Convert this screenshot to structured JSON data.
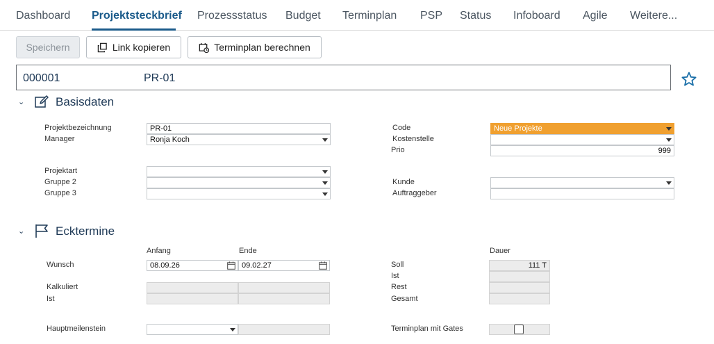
{
  "tabs": [
    "Dashboard",
    "Projektsteckbrief",
    "Prozessstatus",
    "Budget",
    "Terminplan",
    "PSP",
    "Status",
    "Infoboard",
    "Agile",
    "Weitere..."
  ],
  "toolbar": {
    "save": "Speichern",
    "copy_link": "Link kopieren",
    "calc_schedule": "Terminplan berechnen"
  },
  "header": {
    "number": "000001",
    "name": "PR-01"
  },
  "basisdaten": {
    "title": "Basisdaten",
    "projektbezeichnung_label": "Projektbezeichnung",
    "projektbezeichnung": "PR-01",
    "manager_label": "Manager",
    "manager": "Ronja Koch",
    "code_label": "Code",
    "code": "Neue Projekte",
    "kostenstelle_label": "Kostenstelle",
    "kostenstelle": "",
    "prio_label": "Prio",
    "prio": "999",
    "projektart_label": "Projektart",
    "projektart": "",
    "gruppe2_label": "Gruppe 2",
    "gruppe2": "",
    "gruppe3_label": "Gruppe 3",
    "gruppe3": "",
    "kunde_label": "Kunde",
    "kunde": "",
    "auftraggeber_label": "Auftraggeber",
    "auftraggeber": ""
  },
  "ecktermine": {
    "title": "Ecktermine",
    "anfang_label": "Anfang",
    "ende_label": "Ende",
    "dauer_label": "Dauer",
    "wunsch_label": "Wunsch",
    "wunsch_anfang": "08.09.26",
    "wunsch_ende": "09.02.27",
    "kalkuliert_label": "Kalkuliert",
    "ist_label": "Ist",
    "soll_label": "Soll",
    "soll_dauer": "111 T",
    "ist2_label": "Ist",
    "rest_label": "Rest",
    "gesamt_label": "Gesamt",
    "hauptmeilenstein_label": "Hauptmeilenstein",
    "terminplan_gates_label": "Terminplan mit Gates",
    "terminplan_gates_checked": false
  },
  "colors": {
    "accent": "#1a5a8a",
    "code_highlight": "#f0a030"
  }
}
